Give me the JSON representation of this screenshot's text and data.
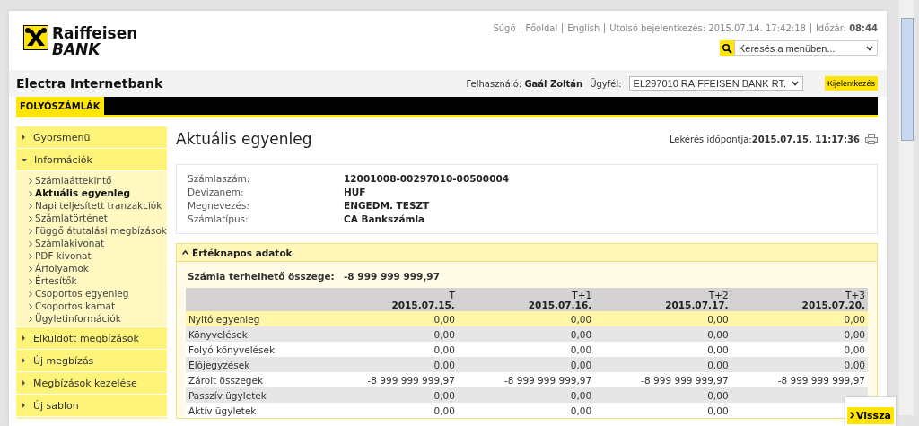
{
  "logo": {
    "line_1": "Raiffeisen",
    "line_2": "BANK"
  },
  "top_links": [
    {
      "kind": "link",
      "text": "Súgó"
    },
    {
      "kind": "link",
      "text": "Főoldal"
    },
    {
      "kind": "link",
      "text": "English"
    },
    {
      "kind": "info",
      "label": "Utolsó bejelentkezés:",
      "value": "2015.07.14. 17:42:18"
    },
    {
      "kind": "info",
      "label": "Időzár:",
      "value": "08:44",
      "bold": true
    }
  ],
  "menu_search": {
    "placeholder": "Keresés a menüben..."
  },
  "app_title": "Electra Internetbank",
  "user": {
    "label": "Felhasználó:",
    "name": "Gaál Zoltán"
  },
  "client": {
    "label": "Ügyfél:",
    "value": "EL297010 RAIFFEISEN BANK RT."
  },
  "logout_button": "Kijelentkezés",
  "nav_tabs": [
    {
      "label": "FOLYÓSZÁMLÁK",
      "selected": true
    }
  ],
  "sidebar": {
    "items": [
      {
        "label": "Gyorsmenü",
        "expanded": false
      },
      {
        "label": "Információk",
        "expanded": true,
        "children": [
          {
            "label": "Számlaáttekintő",
            "selected": false
          },
          {
            "label": "Aktuális egyenleg",
            "selected": true
          },
          {
            "label": "Napi teljesített tranzakciók",
            "selected": false
          },
          {
            "label": "Számlatörténet",
            "selected": false
          },
          {
            "label": "Függő átutalási megbízások",
            "selected": false
          },
          {
            "label": "Számlakivonat",
            "selected": false
          },
          {
            "label": "PDF kivonat",
            "selected": false
          },
          {
            "label": "Árfolyamok",
            "selected": false
          },
          {
            "label": "Értesítők",
            "selected": false
          },
          {
            "label": "Csoportos egyenleg",
            "selected": false
          },
          {
            "label": "Csoportos kamat",
            "selected": false
          },
          {
            "label": "Ügyletinformációk",
            "selected": false
          }
        ]
      },
      {
        "label": "Elküldött megbízások",
        "expanded": false
      },
      {
        "label": "Új megbízás",
        "expanded": false
      },
      {
        "label": "Megbízások kezelése",
        "expanded": false
      },
      {
        "label": "Új sablon",
        "expanded": false
      }
    ]
  },
  "page_title": "Aktuális egyenleg",
  "query_time": {
    "label": "Lekérés időpontja:",
    "value": "2015.07.15. 11:17:36"
  },
  "account_details": [
    {
      "label": "Számlaszám:",
      "value": "12001008-00297010-00500004"
    },
    {
      "label": "Devizanem:",
      "value": "HUF"
    },
    {
      "label": "Megnevezés:",
      "value": "ENGEDM. TESZT"
    },
    {
      "label": "Számlatípus:",
      "value": "CA Bankszámla"
    }
  ],
  "value_date_panel": {
    "title": "Értéknapos adatok",
    "expanded": true,
    "chargeable": {
      "label": "Számla terhelhető összege:",
      "value": "-8 999 999 999,97"
    },
    "table": {
      "columns": [
        {
          "day": "T",
          "date": "2015.07.15."
        },
        {
          "day": "T+1",
          "date": "2015.07.16."
        },
        {
          "day": "T+2",
          "date": "2015.07.17."
        },
        {
          "day": "T+3",
          "date": "2015.07.20."
        }
      ],
      "rows": [
        {
          "label": "Nyitó egyenleg",
          "highlighted": true,
          "values": [
            "0,00",
            "0,00",
            "0,00",
            "0,00"
          ]
        },
        {
          "label": "Könyvelések",
          "highlighted": false,
          "values": [
            "0,00",
            "0,00",
            "0,00",
            "0,00"
          ]
        },
        {
          "label": "Folyó könyvelések",
          "highlighted": false,
          "values": [
            "0,00",
            "0,00",
            "0,00",
            "0,00"
          ]
        },
        {
          "label": "Előjegyzések",
          "highlighted": false,
          "values": [
            "0,00",
            "0,00",
            "0,00",
            "0,00"
          ]
        },
        {
          "label": "Zárolt összegek",
          "highlighted": false,
          "values": [
            "-8 999 999 999,97",
            "-8 999 999 999,97",
            "-8 999 999 999,97",
            "-8 999 999 999,97"
          ]
        },
        {
          "label": "Passzív ügyletek",
          "highlighted": false,
          "values": [
            "0,00",
            "0,00",
            "0,00"
          ]
        },
        {
          "label": "Aktív ügyletek",
          "highlighted": false,
          "values": [
            "0,00",
            "0,00",
            "0,00"
          ]
        }
      ]
    }
  },
  "back_button": "Vissza"
}
